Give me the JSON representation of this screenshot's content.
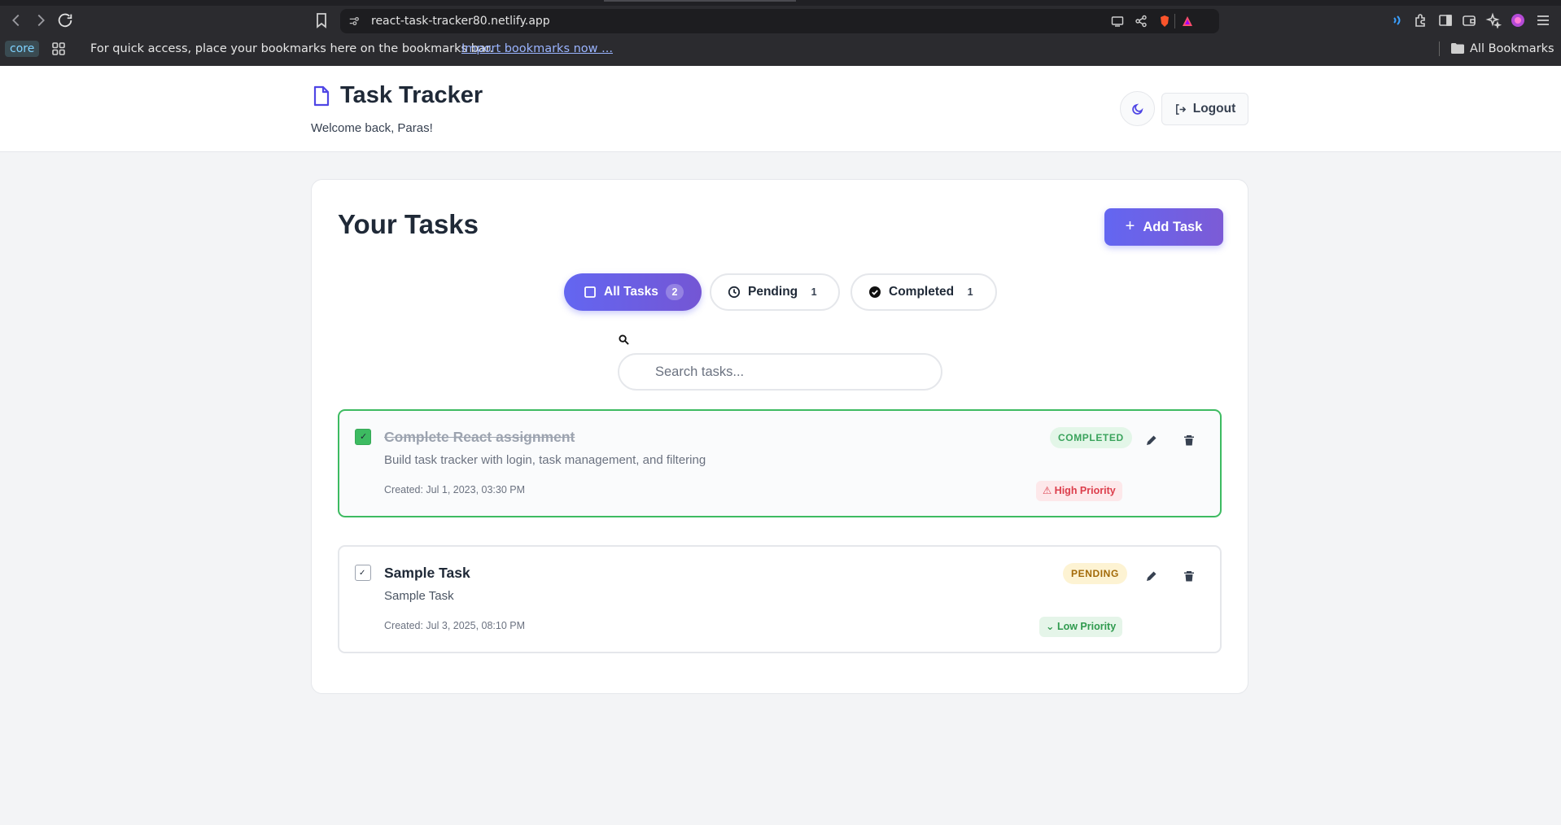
{
  "browser": {
    "url": "react-task-tracker80.netlify.app",
    "profile_chip": "core",
    "bookmarks_hint": "For quick access, place your bookmarks here on the bookmarks bar.",
    "import_link": "Import bookmarks now ...",
    "all_bookmarks": "All Bookmarks"
  },
  "header": {
    "title": "Task Tracker",
    "welcome": "Welcome back, Paras!",
    "logout_label": "Logout",
    "theme_icon": "moon-icon",
    "brand_icon": "document-icon"
  },
  "main": {
    "section_title": "Your Tasks",
    "add_task_label": "Add Task",
    "filters": [
      {
        "label": "All Tasks",
        "count": "2",
        "icon": "square-icon",
        "active": true
      },
      {
        "label": "Pending",
        "count": "1",
        "icon": "clock-icon",
        "active": false
      },
      {
        "label": "Completed",
        "count": "1",
        "icon": "check-circle-icon",
        "active": false
      }
    ],
    "search": {
      "placeholder": "Search tasks...",
      "value": ""
    },
    "tasks": [
      {
        "title": "Complete React assignment",
        "description": "Build task tracker with login, task management, and filtering",
        "created": "Created: Jul 1, 2023, 03:30 PM",
        "status": "COMPLETED",
        "priority": "⚠ High Priority",
        "completed": true
      },
      {
        "title": "Sample Task",
        "description": "Sample Task",
        "created": "Created: Jul 3, 2025, 08:10 PM",
        "status": "PENDING",
        "priority": "⌄ Low Priority",
        "completed": false
      }
    ]
  },
  "colors": {
    "accent": "#6366f1",
    "accent_end": "#7456d4",
    "completed_green": "#3dbb61",
    "high_priority": "#dc3d4b",
    "low_priority": "#2f9a4e",
    "pending_amber": "#a36a08"
  }
}
